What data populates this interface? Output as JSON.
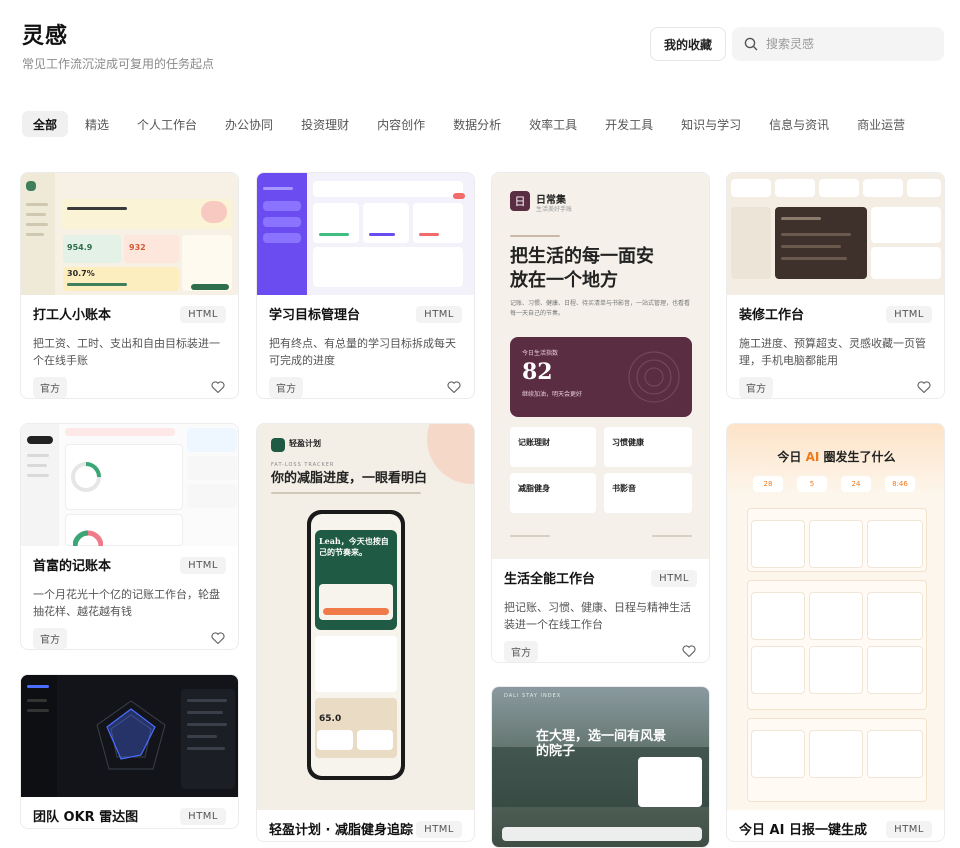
{
  "header": {
    "title": "灵感",
    "subtitle": "常见工作流沉淀成可复用的任务起点",
    "favorites_label": "我的收藏",
    "search_placeholder": "搜索灵感"
  },
  "tabs": [
    "全部",
    "精选",
    "个人工作台",
    "办公协同",
    "投资理财",
    "内容创作",
    "数据分析",
    "效率工具",
    "开发工具",
    "知识与学习",
    "信息与资讯",
    "商业运营"
  ],
  "cards": [
    {
      "title": "打工人小账本",
      "badge": "HTML",
      "desc": "把工资、工时、支出和自由目标装进一个在线手账",
      "tag": "官方"
    },
    {
      "title": "学习目标管理台",
      "badge": "HTML",
      "desc": "把有终点、有总量的学习目标拆成每天可完成的进度",
      "tag": "官方"
    },
    {
      "title": "生活全能工作台",
      "badge": "HTML",
      "desc": "把记账、习惯、健康、日程与精神生活装进一个在线工作台",
      "tag": "官方"
    },
    {
      "title": "装修工作台",
      "badge": "HTML",
      "desc": "施工进度、预算超支、灵感收藏一页管理，手机电脑都能用",
      "tag": "官方"
    },
    {
      "title": "首富的记账本",
      "badge": "HTML",
      "desc": "一个月花光十个亿的记账工作台，轮盘抽花样、越花越有钱",
      "tag": "官方"
    },
    {
      "title": "轻盈计划 · 减脂健身追踪",
      "badge": "HTML"
    },
    {
      "title": "团队 OKR 雷达图",
      "badge": "HTML"
    },
    {
      "title": "今日 AI 日报一键生成",
      "badge": "HTML"
    }
  ],
  "thumbs": {
    "life": {
      "app": "日常集",
      "app_sub": "生活美好手账",
      "headline": "把生活的每一面安放在一个地方",
      "intro": "记账、习惯、健康、日程、待买清单与书影音，一站式管理，也看看每一天自己的节奏。",
      "days_label": "今日生活指数",
      "days_value": "82",
      "days_note": "继续加油，明天会更好",
      "modules": [
        "记账理财",
        "习惯健康",
        "减脂健身",
        "书影音"
      ]
    },
    "fitness": {
      "brand": "轻盈计划",
      "kicker": "FAT-LOSS TRACKER",
      "headline": "你的减脂进度，一眼看明白",
      "greeting": "Leah，今天也按自己的节奏来。",
      "weight": "65.0"
    },
    "dali": {
      "kicker": "DALI STAY INDEX",
      "headline": "在大理，选一间有风景的院子"
    },
    "ai": {
      "headline_pre": "今日 ",
      "headline_ai": "AI",
      "headline_post": " 圈发生了什么",
      "stats": [
        "28",
        "5",
        "24",
        "8:46"
      ]
    },
    "account": {
      "value": "954.9",
      "value2": "932",
      "percent": "30.7%"
    }
  },
  "colors": {
    "accent": "#111111",
    "plum": "#5b2d42",
    "green": "#1f5a44",
    "orange": "#f07a4a"
  }
}
